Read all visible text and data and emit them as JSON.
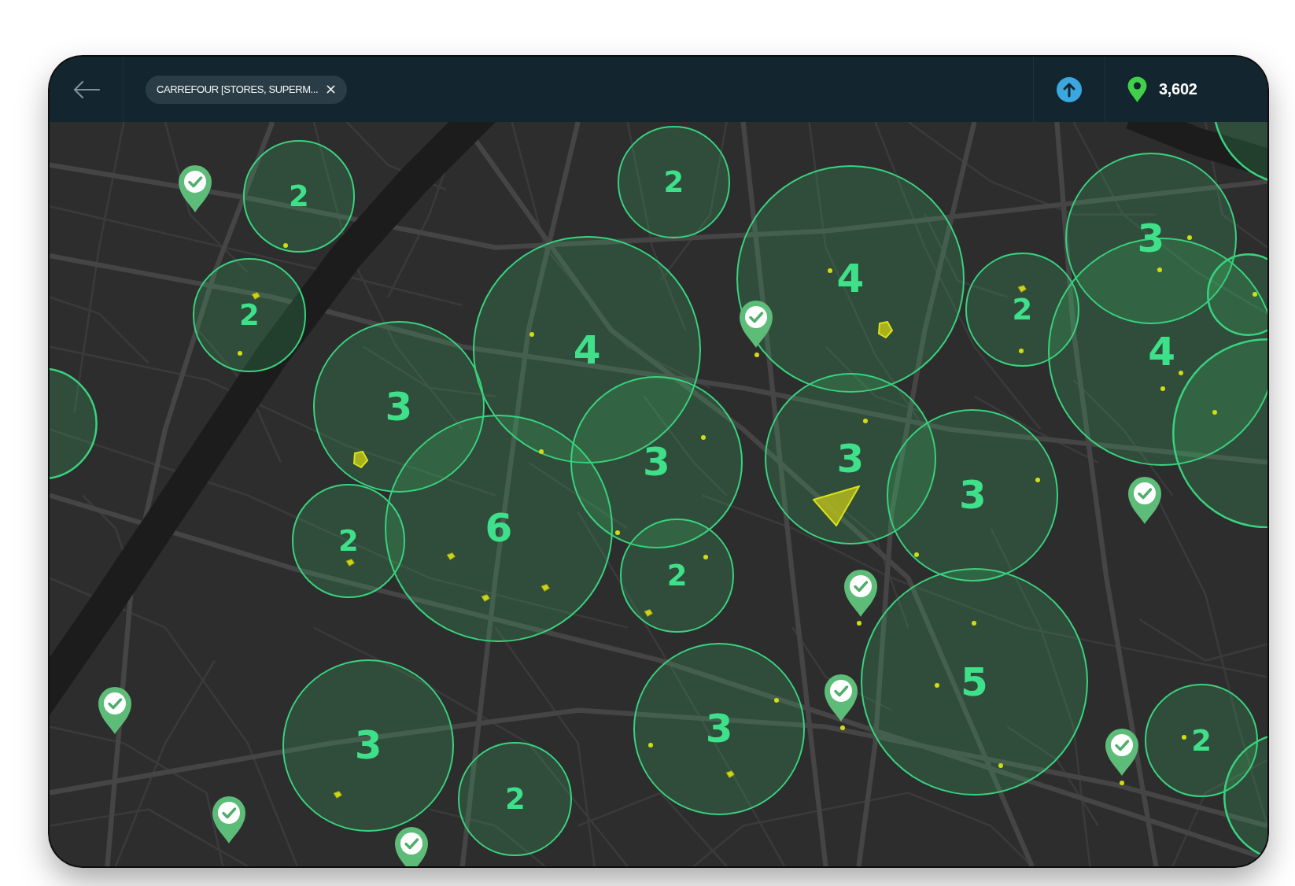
{
  "header": {
    "filter_chip": {
      "label": "CARREFOUR [STORES, SUPERM..."
    },
    "location_count": "3,602"
  },
  "map": {
    "clusters": [
      {
        "kind": "clipped"
      },
      {
        "kind": "counted",
        "count": "2"
      },
      {
        "kind": "counted",
        "count": "2"
      },
      {
        "kind": "counted",
        "count": "3"
      },
      {
        "kind": "counted",
        "count": "4"
      },
      {
        "kind": "counted",
        "count": "2"
      },
      {
        "kind": "clipped"
      },
      {
        "kind": "counted",
        "count": "2"
      },
      {
        "kind": "counted",
        "count": "4"
      },
      {
        "kind": "counted",
        "count": "4"
      },
      {
        "kind": "counted",
        "count": "3"
      },
      {
        "kind": "clipped"
      },
      {
        "kind": "clipped"
      },
      {
        "kind": "counted",
        "count": "3"
      },
      {
        "kind": "counted",
        "count": "3"
      },
      {
        "kind": "counted",
        "count": "3"
      },
      {
        "kind": "counted",
        "count": "6"
      },
      {
        "kind": "counted",
        "count": "2"
      },
      {
        "kind": "counted",
        "count": "2"
      },
      {
        "kind": "counted",
        "count": "5"
      },
      {
        "kind": "counted",
        "count": "3"
      },
      {
        "kind": "counted",
        "count": "3"
      },
      {
        "kind": "counted",
        "count": "2"
      },
      {
        "kind": "clipped"
      },
      {
        "kind": "counted",
        "count": "2"
      }
    ],
    "pins": [
      {
        "checked": true
      },
      {
        "checked": true
      },
      {
        "checked": true
      },
      {
        "checked": true
      },
      {
        "checked": true
      },
      {
        "checked": true
      },
      {
        "checked": true
      },
      {
        "checked": true
      },
      {
        "checked": true
      }
    ]
  }
}
